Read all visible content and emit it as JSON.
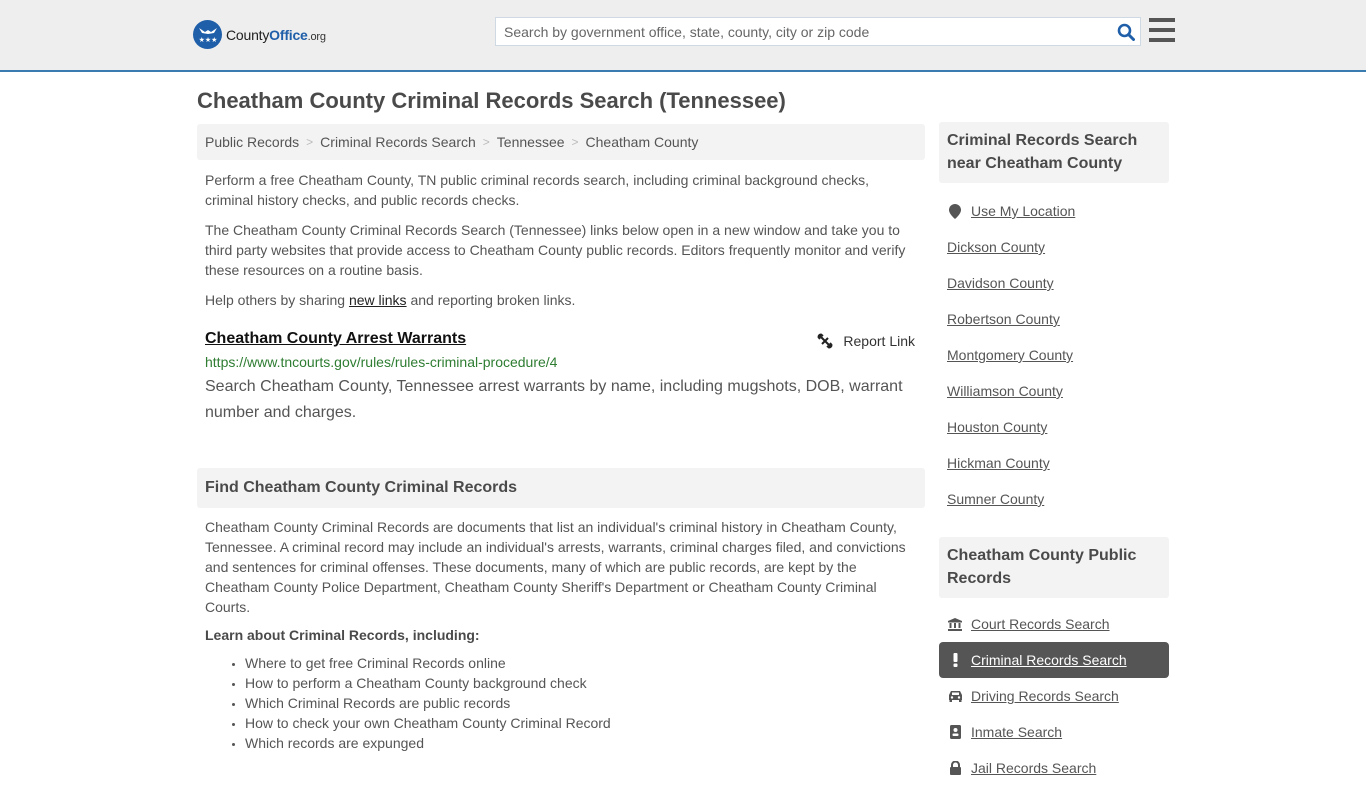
{
  "header": {
    "logo": {
      "text_main": "County",
      "text_brand": "Office",
      "text_tld": ".org"
    },
    "search": {
      "placeholder": "Search by government office, state, county, city or zip code",
      "value": ""
    },
    "icons": {
      "search": "search-icon",
      "menu": "hamburger-menu-icon"
    }
  },
  "page": {
    "title": "Cheatham County Criminal Records Search (Tennessee)"
  },
  "breadcrumb": [
    {
      "label": "Public Records"
    },
    {
      "label": "Criminal Records Search"
    },
    {
      "label": "Tennessee"
    },
    {
      "label": "Cheatham County"
    }
  ],
  "intro": {
    "p1": "Perform a free Cheatham County, TN public criminal records search, including criminal background checks, criminal history checks, and public records checks.",
    "p2": "The Cheatham County Criminal Records Search (Tennessee) links below open in a new window and take you to third party websites that provide access to Cheatham County public records. Editors frequently monitor and verify these resources on a routine basis.",
    "p3_before": "Help others by sharing ",
    "p3_link": "new links",
    "p3_after": " and reporting broken links."
  },
  "results": [
    {
      "title": "Cheatham County Arrest Warrants",
      "url": "https://www.tncourts.gov/rules/rules-criminal-procedure/4",
      "description": "Search Cheatham County, Tennessee arrest warrants by name, including mugshots, DOB, warrant number and charges.",
      "report_label": "Report Link"
    }
  ],
  "find_section": {
    "heading": "Find Cheatham County Criminal Records",
    "body": "Cheatham County Criminal Records are documents that list an individual's criminal history in Cheatham County, Tennessee. A criminal record may include an individual's arrests, warrants, criminal charges filed, and convictions and sentences for criminal offenses. These documents, many of which are public records, are kept by the Cheatham County Police Department, Cheatham County Sheriff's Department or Cheatham County Criminal Courts.",
    "learn_heading": "Learn about Criminal Records, including:",
    "learn_items": [
      "Where to get free Criminal Records online",
      "How to perform a Cheatham County background check",
      "Which Criminal Records are public records",
      "How to check your own Cheatham County Criminal Record",
      "Which records are expunged"
    ]
  },
  "sidebar": {
    "nearby": {
      "heading": "Criminal Records Search near Cheatham County",
      "use_location": "Use My Location",
      "counties": [
        "Dickson County",
        "Davidson County",
        "Robertson County",
        "Montgomery County",
        "Williamson County",
        "Houston County",
        "Hickman County",
        "Sumner County"
      ]
    },
    "public_records": {
      "heading": "Cheatham County Public Records",
      "items": [
        {
          "label": "Court Records Search",
          "icon": "courthouse-icon",
          "active": false
        },
        {
          "label": "Criminal Records Search",
          "icon": "exclamation-icon",
          "active": true
        },
        {
          "label": "Driving Records Search",
          "icon": "car-icon",
          "active": false
        },
        {
          "label": "Inmate Search",
          "icon": "id-badge-icon",
          "active": false
        },
        {
          "label": "Jail Records Search",
          "icon": "lock-icon",
          "active": false
        }
      ]
    }
  },
  "colors": {
    "brand_blue": "#1f5ea8",
    "header_border": "#3a7bb0",
    "url_green": "#2e7d32",
    "active_item_bg": "#555555"
  }
}
